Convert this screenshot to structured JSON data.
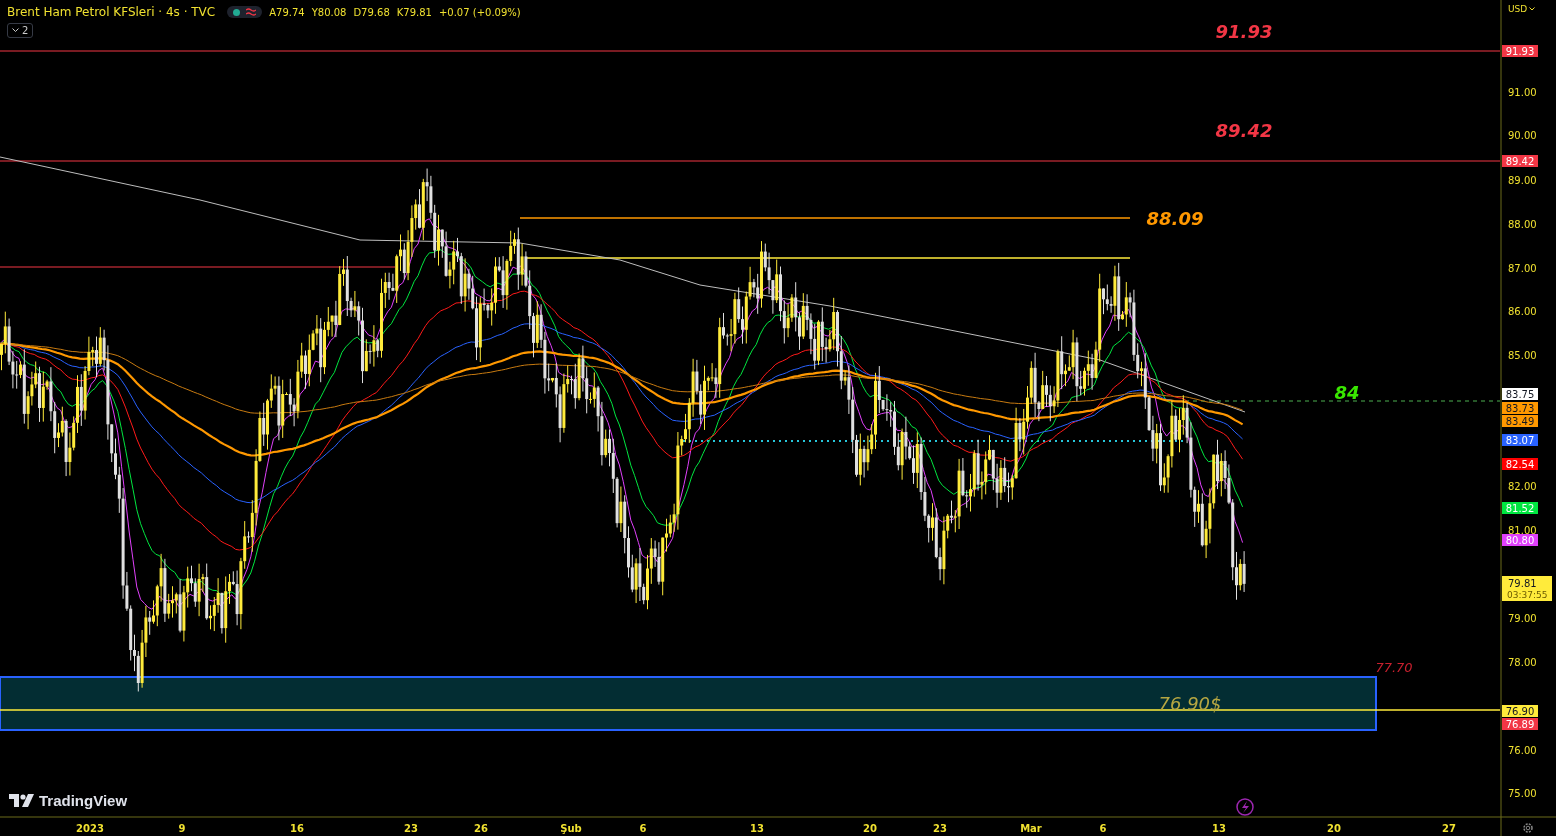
{
  "header": {
    "symbol": "Brent Ham Petrol KFSleri · 4s · TVC",
    "ohlc": [
      "A79.74",
      "Y80.08",
      "D79.68",
      "K79.81"
    ],
    "change": "+0.07 (+0.09%)",
    "indicators_count": "2"
  },
  "currency": "USD",
  "price_ticks": [
    "91.00",
    "90.00",
    "89.00",
    "88.00",
    "87.00",
    "86.00",
    "85.00",
    "82.00",
    "81.00",
    "79.00",
    "78.00",
    "76.00",
    "75.00"
  ],
  "price_tags": [
    {
      "text": "91.93",
      "color": "#f23645"
    },
    {
      "text": "89.42",
      "color": "#f23645"
    },
    {
      "text": "83.75",
      "color": "#ffffff"
    },
    {
      "text": "83.73",
      "color": "#ff9800"
    },
    {
      "text": "83.49",
      "color": "#ff9800"
    },
    {
      "text": "83.07",
      "color": "#2962ff"
    },
    {
      "text": "82.54",
      "color": "#ff0000"
    },
    {
      "text": "81.52",
      "color": "#00e640"
    },
    {
      "text": "80.80",
      "color": "#e040fb"
    },
    {
      "text": "76.90",
      "color": "#ffeb3b"
    },
    {
      "text": "76.89",
      "color": "#f23645"
    }
  ],
  "last_price": {
    "price": "79.81",
    "countdown": "03:37:55"
  },
  "chart_labels": [
    {
      "text": "91.93",
      "color": "#f23645"
    },
    {
      "text": "89.42",
      "color": "#f23645"
    },
    {
      "text": "88.09",
      "color": "#ff9800"
    },
    {
      "text": "84",
      "color": "#39e600"
    },
    {
      "text": "77.70",
      "color": "#c8202e"
    },
    {
      "text": "76.90$",
      "color": "#b5a642"
    }
  ],
  "time_axis": [
    "2023",
    "9",
    "16",
    "23",
    "26",
    "Şub",
    "6",
    "13",
    "20",
    "23",
    "Mar",
    "6",
    "13",
    "20",
    "27"
  ],
  "logo_text": "TradingView"
}
